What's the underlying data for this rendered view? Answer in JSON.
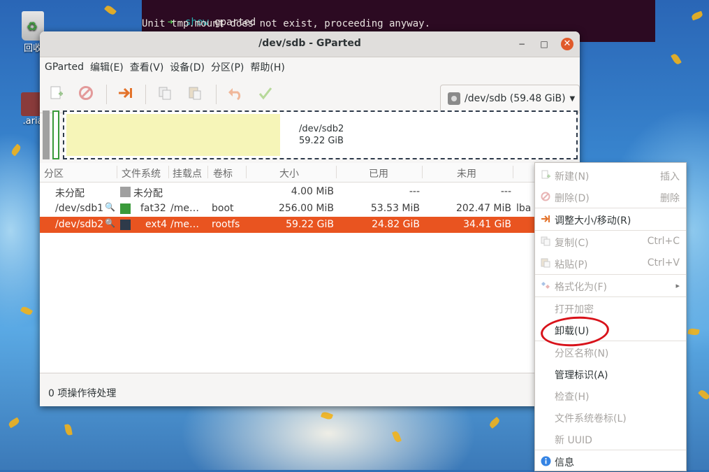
{
  "desktop": {
    "icons": [
      {
        "label": "回收"
      },
      {
        "label": ".aria"
      }
    ]
  },
  "terminal": {
    "prompt": "➜",
    "command_keyword": "show",
    "command_arg": "gparted",
    "output": "Unit tmp.mount does not exist, proceeding anyway."
  },
  "window": {
    "title": "/dev/sdb - GParted",
    "controls": {
      "minimize": "−",
      "maximize": "□",
      "close": "✕"
    }
  },
  "menubar": [
    "GParted",
    "编辑(E)",
    "查看(V)",
    "设备(D)",
    "分区(P)",
    "帮助(H)"
  ],
  "toolbar": {
    "device_selector": "/dev/sdb (59.48 GiB)"
  },
  "visual": {
    "name": "/dev/sdb2",
    "size": "59.22 GiB"
  },
  "table": {
    "headers": [
      "分区",
      "文件系统",
      "挂载点",
      "卷标",
      "大小",
      "已用",
      "未用"
    ],
    "rows": [
      {
        "partition": "未分配",
        "fs": "未分配",
        "mount": "",
        "label": "",
        "size": "4.00 MiB",
        "used": "---",
        "unused": "---",
        "flags": "",
        "color": "#a0a0a0"
      },
      {
        "partition": "/dev/sdb1",
        "fs": "fat32",
        "mount": "/me…",
        "label": "boot",
        "size": "256.00 MiB",
        "used": "53.53 MiB",
        "unused": "202.47 MiB",
        "flags": "lba",
        "color": "#3a9a3a"
      },
      {
        "partition": "/dev/sdb2",
        "fs": "ext4",
        "mount": "/me…",
        "label": "rootfs",
        "size": "59.22 GiB",
        "used": "24.82 GiB",
        "unused": "34.41 GiB",
        "flags": "",
        "color": "#2e3a4a"
      }
    ]
  },
  "statusbar": "0 项操作待处理",
  "context_menu": {
    "items": [
      {
        "label": "新建(N)",
        "accel": "插入"
      },
      {
        "label": "删除(D)",
        "accel": "删除"
      },
      {
        "label": "调整大小/移动(R)",
        "accel": ""
      },
      {
        "label": "复制(C)",
        "accel": "Ctrl+C"
      },
      {
        "label": "粘贴(P)",
        "accel": "Ctrl+V"
      },
      {
        "label": "格式化为(F)",
        "accel": "▸"
      },
      {
        "label": "打开加密",
        "accel": ""
      },
      {
        "label": "卸载(U)",
        "accel": ""
      },
      {
        "label": "分区名称(N)",
        "accel": ""
      },
      {
        "label": "管理标识(A)",
        "accel": ""
      },
      {
        "label": "检查(H)",
        "accel": ""
      },
      {
        "label": "文件系统卷标(L)",
        "accel": ""
      },
      {
        "label": "新 UUID",
        "accel": ""
      },
      {
        "label": "信息",
        "accel": ""
      }
    ]
  }
}
